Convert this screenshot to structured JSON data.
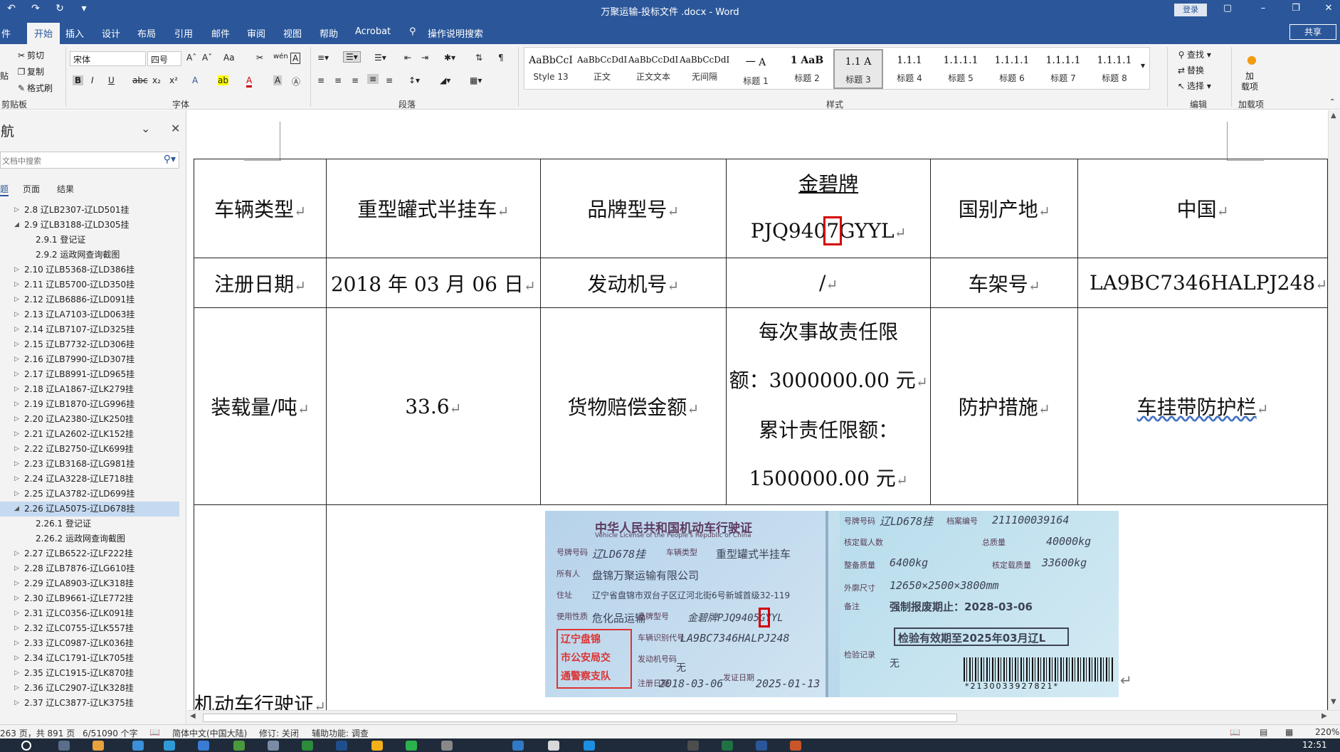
{
  "window": {
    "title": "万聚运输-投标文件 .docx  -  Word",
    "login_label": "登录",
    "qat": [
      "↶",
      "↷",
      "↻",
      "▾"
    ],
    "controls": [
      "▢",
      "–",
      "❐",
      "✕"
    ]
  },
  "tabs": {
    "items": [
      "件",
      "开始",
      "插入",
      "设计",
      "布局",
      "引用",
      "邮件",
      "审阅",
      "视图",
      "帮助",
      "Acrobat",
      "操作说明搜索"
    ],
    "active": "开始",
    "share": "共享"
  },
  "ribbon": {
    "clipboard": {
      "paste": "贴",
      "cut": "剪切",
      "copy": "复制",
      "format_painter": "格式刷",
      "label": "剪贴板"
    },
    "font": {
      "name": "宋体",
      "size": "四号",
      "label": "字体",
      "buttons": [
        "Aˆ",
        "Aˇ",
        "Aa",
        "✂",
        "wén",
        "A"
      ],
      "format_buttons": [
        "B",
        "I",
        "U",
        "abc",
        "x₂",
        "x²",
        "A",
        "ab",
        "A",
        "A",
        "Ⓐ"
      ]
    },
    "paragraph": {
      "label": "段落"
    },
    "styles": {
      "label": "样式",
      "items": [
        {
          "sample": "AaBbCcI",
          "name": "Style 13"
        },
        {
          "sample": "AaBbCcDdI",
          "name": "正文"
        },
        {
          "sample": "AaBbCcDdI",
          "name": "正文文本"
        },
        {
          "sample": "AaBbCcDdI",
          "name": "无间隔"
        },
        {
          "sample": "一  A",
          "name": "标题 1"
        },
        {
          "sample": "1  AaB",
          "name": "标题 2"
        },
        {
          "sample": "1.1  A",
          "name": "标题 3"
        },
        {
          "sample": "1.1.1",
          "name": "标题 4"
        },
        {
          "sample": "1.1.1.1",
          "name": "标题 5"
        },
        {
          "sample": "1.1.1.1",
          "name": "标题 6"
        },
        {
          "sample": "1.1.1.1",
          "name": "标题 7"
        },
        {
          "sample": "1.1.1.1",
          "name": "标题 8"
        }
      ],
      "selected": "标题 3"
    },
    "editing": {
      "find": "查找",
      "replace": "替换",
      "select": "选择",
      "label": "编辑"
    },
    "addins": {
      "button": "加\n载项",
      "label": "加载项"
    }
  },
  "nav": {
    "title": "导航",
    "search_placeholder": "文档中搜索",
    "tabs": [
      "标题",
      "页面",
      "结果"
    ],
    "items": [
      {
        "text": "2.8 辽LB2307-辽LD501挂",
        "level": 1,
        "arrow": "▷"
      },
      {
        "text": "2.9 辽LB3188-辽LD305挂",
        "level": 1,
        "arrow": "◢"
      },
      {
        "text": "2.9.1 登记证",
        "level": 2,
        "arrow": ""
      },
      {
        "text": "2.9.2 运政网查询截图",
        "level": 2,
        "arrow": ""
      },
      {
        "text": "2.10 辽LB5368-辽LD386挂",
        "level": 1,
        "arrow": "▷"
      },
      {
        "text": "2.11 辽LB5700-辽LD350挂",
        "level": 1,
        "arrow": "▷"
      },
      {
        "text": "2.12 辽LB6886-辽LD091挂",
        "level": 1,
        "arrow": "▷"
      },
      {
        "text": "2.13 辽LA7103-辽LD063挂",
        "level": 1,
        "arrow": "▷"
      },
      {
        "text": "2.14 辽LB7107-辽LD325挂",
        "level": 1,
        "arrow": "▷"
      },
      {
        "text": "2.15 辽LB7732-辽LD306挂",
        "level": 1,
        "arrow": "▷"
      },
      {
        "text": "2.16 辽LB7990-辽LD307挂",
        "level": 1,
        "arrow": "▷"
      },
      {
        "text": "2.17 辽LB8991-辽LD965挂",
        "level": 1,
        "arrow": "▷"
      },
      {
        "text": "2.18 辽LA1867-辽LK279挂",
        "level": 1,
        "arrow": "▷"
      },
      {
        "text": "2.19 辽LB1870-辽LG996挂",
        "level": 1,
        "arrow": "▷"
      },
      {
        "text": "2.20 辽LA2380-辽LK250挂",
        "level": 1,
        "arrow": "▷"
      },
      {
        "text": "2.21 辽LA2602-辽LK152挂",
        "level": 1,
        "arrow": "▷"
      },
      {
        "text": "2.22 辽LB2750-辽LK699挂",
        "level": 1,
        "arrow": "▷"
      },
      {
        "text": "2.23 辽LB3168-辽LG981挂",
        "level": 1,
        "arrow": "▷"
      },
      {
        "text": "2.24 辽LA3228-辽LE718挂",
        "level": 1,
        "arrow": "▷"
      },
      {
        "text": "2.25 辽LA3782-辽LD699挂",
        "level": 1,
        "arrow": "▷"
      },
      {
        "text": "2.26 辽LA5075-辽LD678挂",
        "level": 1,
        "arrow": "◢",
        "selected": true
      },
      {
        "text": "2.26.1 登记证",
        "level": 2,
        "arrow": ""
      },
      {
        "text": "2.26.2 运政网查询截图",
        "level": 2,
        "arrow": ""
      },
      {
        "text": "2.27 辽LB6522-辽LF222挂",
        "level": 1,
        "arrow": "▷"
      },
      {
        "text": "2.28 辽LB7876-辽LG610挂",
        "level": 1,
        "arrow": "▷"
      },
      {
        "text": "2.29 辽LA8903-辽LK318挂",
        "level": 1,
        "arrow": "▷"
      },
      {
        "text": "2.30 辽LB9661-辽LE772挂",
        "level": 1,
        "arrow": "▷"
      },
      {
        "text": "2.31 辽LC0356-辽LK091挂",
        "level": 1,
        "arrow": "▷"
      },
      {
        "text": "2.32 辽LC0755-辽LK557挂",
        "level": 1,
        "arrow": "▷"
      },
      {
        "text": "2.33 辽LC0987-辽LK036挂",
        "level": 1,
        "arrow": "▷"
      },
      {
        "text": "2.34 辽LC1791-辽LK705挂",
        "level": 1,
        "arrow": "▷"
      },
      {
        "text": "2.35 辽LC1915-辽LK870挂",
        "level": 1,
        "arrow": "▷"
      },
      {
        "text": "2.36 辽LC2907-辽LK328挂",
        "level": 1,
        "arrow": "▷"
      },
      {
        "text": "2.37 辽LC3877-辽LK375挂",
        "level": 1,
        "arrow": "▷"
      }
    ]
  },
  "table": {
    "row1": {
      "label1": "车辆类型",
      "value1": "重型罐式半挂车",
      "label2": "品牌型号",
      "value2_line1": "金碧牌",
      "value2_line2a": "PJQ940",
      "value2_line2b": "7",
      "value2_line2c": "GYYL",
      "label3": "国别产地",
      "value3": "中国"
    },
    "row2": {
      "label1": "注册日期",
      "value1": "2018 年 03 月 06 日",
      "label2": "发动机号",
      "value2": "/",
      "label3": "车架号",
      "value3": "LA9BC7346HALPJ248"
    },
    "row3": {
      "label1": "装载量/吨",
      "value1": "33.6",
      "label2": "货物赔偿金额",
      "value2_l1": "每次事故责任限",
      "value2_l2": "额：3000000.00 元",
      "value2_l3": "累计责任限额：",
      "value2_l4": "1500000.00 元",
      "label3": "防护措施",
      "value3": "车挂带防护栏"
    },
    "row4": {
      "label": "机动车行驶证"
    },
    "para_mark": "↵"
  },
  "license": {
    "title": "中华人民共和国机动车行驶证",
    "title_en": "Vehicle License of the People's Republic of China",
    "plate_label": "号牌号码",
    "plate": "辽LD678挂",
    "type_label": "车辆类型",
    "type": "重型罐式半挂车",
    "owner_label": "所有人",
    "owner": "盘锦万聚运输有限公司",
    "address_label": "住址",
    "address": "辽宁省盘锦市双台子区辽河北街6号新城首级32-119",
    "use_label": "使用性质",
    "use": "危化品运输",
    "model_label": "品牌型号",
    "model": "金碧牌PJQ9405GYYL",
    "vin_label": "车辆识别代号",
    "vin": "LA9BC7346HALPJ248",
    "engine_label": "发动机号码",
    "engine": "无",
    "reg_label": "注册日期",
    "reg": "2018-03-06",
    "issue_label": "发证日期",
    "issue": "2025-01-13",
    "stamp_lines": [
      "辽宁盘锦",
      "市公安局交",
      "通警察支队"
    ],
    "r_plate_label": "号牌号码",
    "r_plate": "辽LD678挂",
    "file_label": "档案编号",
    "file": "211100039164",
    "seats_label": "核定载人数",
    "seats": "",
    "gross_label": "总质量",
    "gross": "40000kg",
    "curb_label": "整备质量",
    "curb": "6400kg",
    "load_label": "核定载质量",
    "load": "33600kg",
    "dim_label": "外廓尺寸",
    "dim": "12650×2500×3800mm",
    "note_label": "备注",
    "note": "强制报废期止：2028-03-06",
    "inspect": "检验有效期至2025年03月辽L",
    "record_label": "检验记录",
    "record": "无",
    "barcode_number": "*2130033927821*"
  },
  "status": {
    "page": "263 页，共 891 页",
    "words": "6/51090 个字",
    "lang": "简体中文(中国大陆)",
    "track": "修订: 关闭",
    "access": "辅助功能: 调查",
    "zoom": "220%"
  },
  "taskbar": {
    "clock": "12:51"
  },
  "colors": {
    "brand": "#2b579a",
    "highlight": "#d40000",
    "nav_selected": "#c5d9f1"
  }
}
